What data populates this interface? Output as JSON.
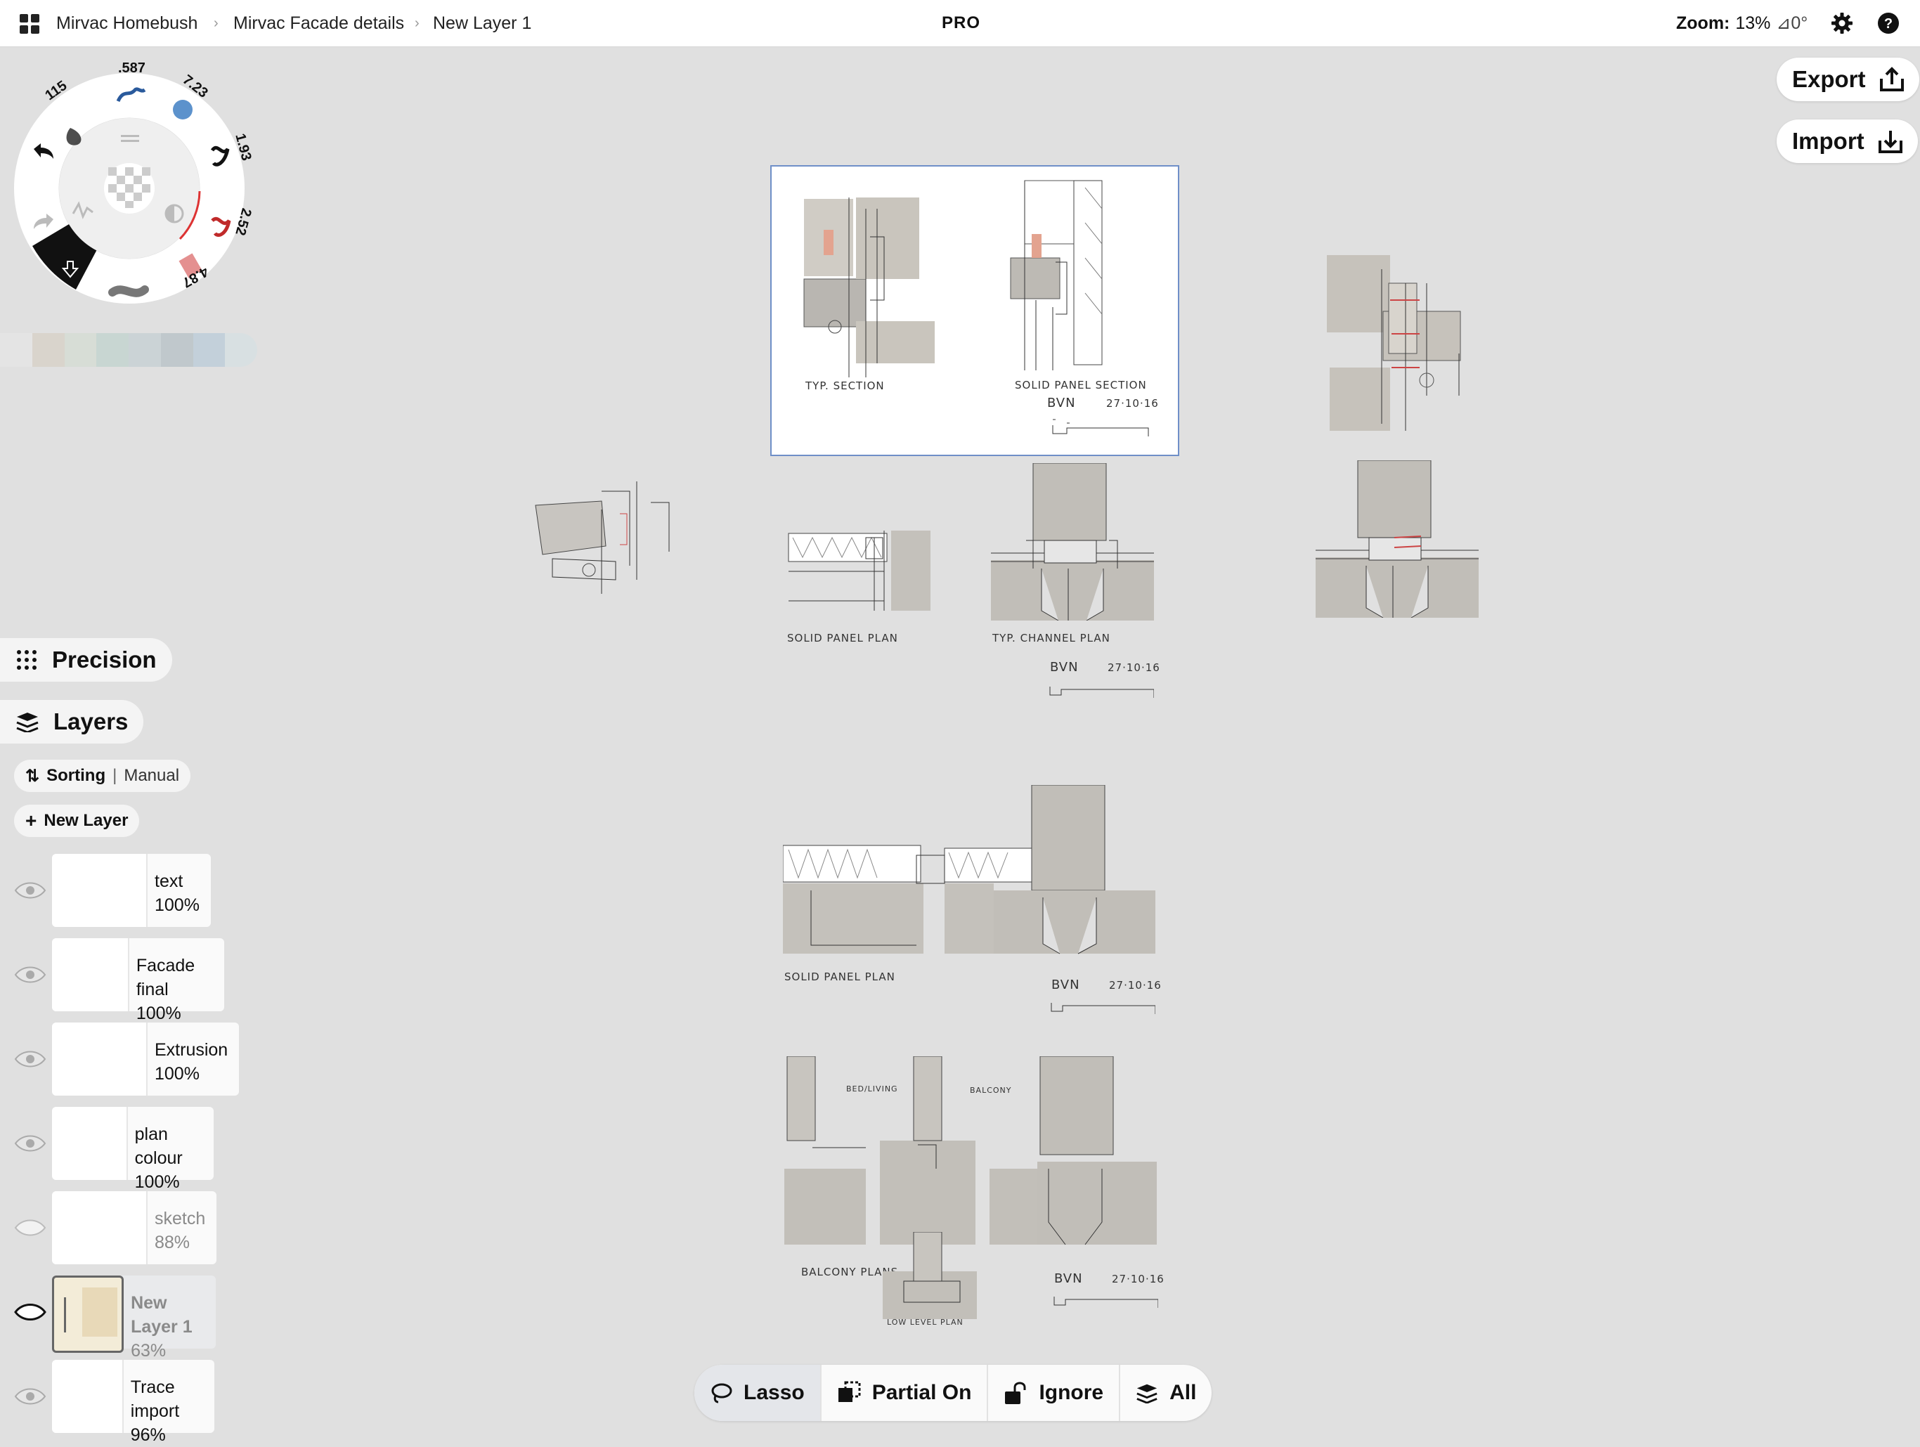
{
  "breadcrumb": {
    "project": "Mirvac Homebush",
    "drawing": "Mirvac Facade details",
    "layer": "New Layer 1"
  },
  "pro_label": "PRO",
  "zoom": {
    "label": "Zoom:",
    "value": "13%",
    "rotation": "⊿0°"
  },
  "export_label": "Export",
  "import_label": "Import",
  "brush_wheel": {
    "sizes": [
      ".587",
      "7.23",
      "1.93",
      "2.52",
      "4.87",
      "115"
    ]
  },
  "palette": [
    "#e4e4e4",
    "#d9d4cc",
    "#d7ddd6",
    "#c8d6d2",
    "#cbd3d6",
    "#c0c8cc",
    "#c3d0da",
    "#d8e0e2"
  ],
  "precision_label": "Precision",
  "layers_label": "Layers",
  "sorting": {
    "label": "Sorting",
    "mode": "Manual"
  },
  "new_layer_label": "New Layer",
  "layers": [
    {
      "name": "text",
      "opacity": "100%",
      "visible": true
    },
    {
      "name": "Facade final",
      "opacity": "100%",
      "visible": true
    },
    {
      "name": "Extrusion",
      "opacity": "100%",
      "visible": true
    },
    {
      "name": "plan colour",
      "opacity": "100%",
      "visible": true
    },
    {
      "name": "sketch",
      "opacity": "88%",
      "visible": false
    },
    {
      "name": "New Layer 1",
      "opacity": "63%",
      "visible": true,
      "selected": true
    },
    {
      "name": "Trace import",
      "opacity": "96%",
      "visible": true
    }
  ],
  "bottom_toolbar": {
    "lasso": "Lasso",
    "partial": "Partial On",
    "ignore": "Ignore",
    "all": "All"
  },
  "canvas_notes": {
    "typ_section": "TYP. SECTION",
    "solid_panel_section": "SOLID PANEL SECTION",
    "bvn": "BVN",
    "date": "27·10·16",
    "solid_panel_plan": "SOLID PANEL PLAN",
    "typ_channel_plan": "TYP. CHANNEL PLAN",
    "balcony_plans": "BALCONY PLANS",
    "bed_living": "BED/LIVING",
    "balcony": "BALCONY",
    "low_level_plan": "LOW LEVEL PLAN"
  }
}
